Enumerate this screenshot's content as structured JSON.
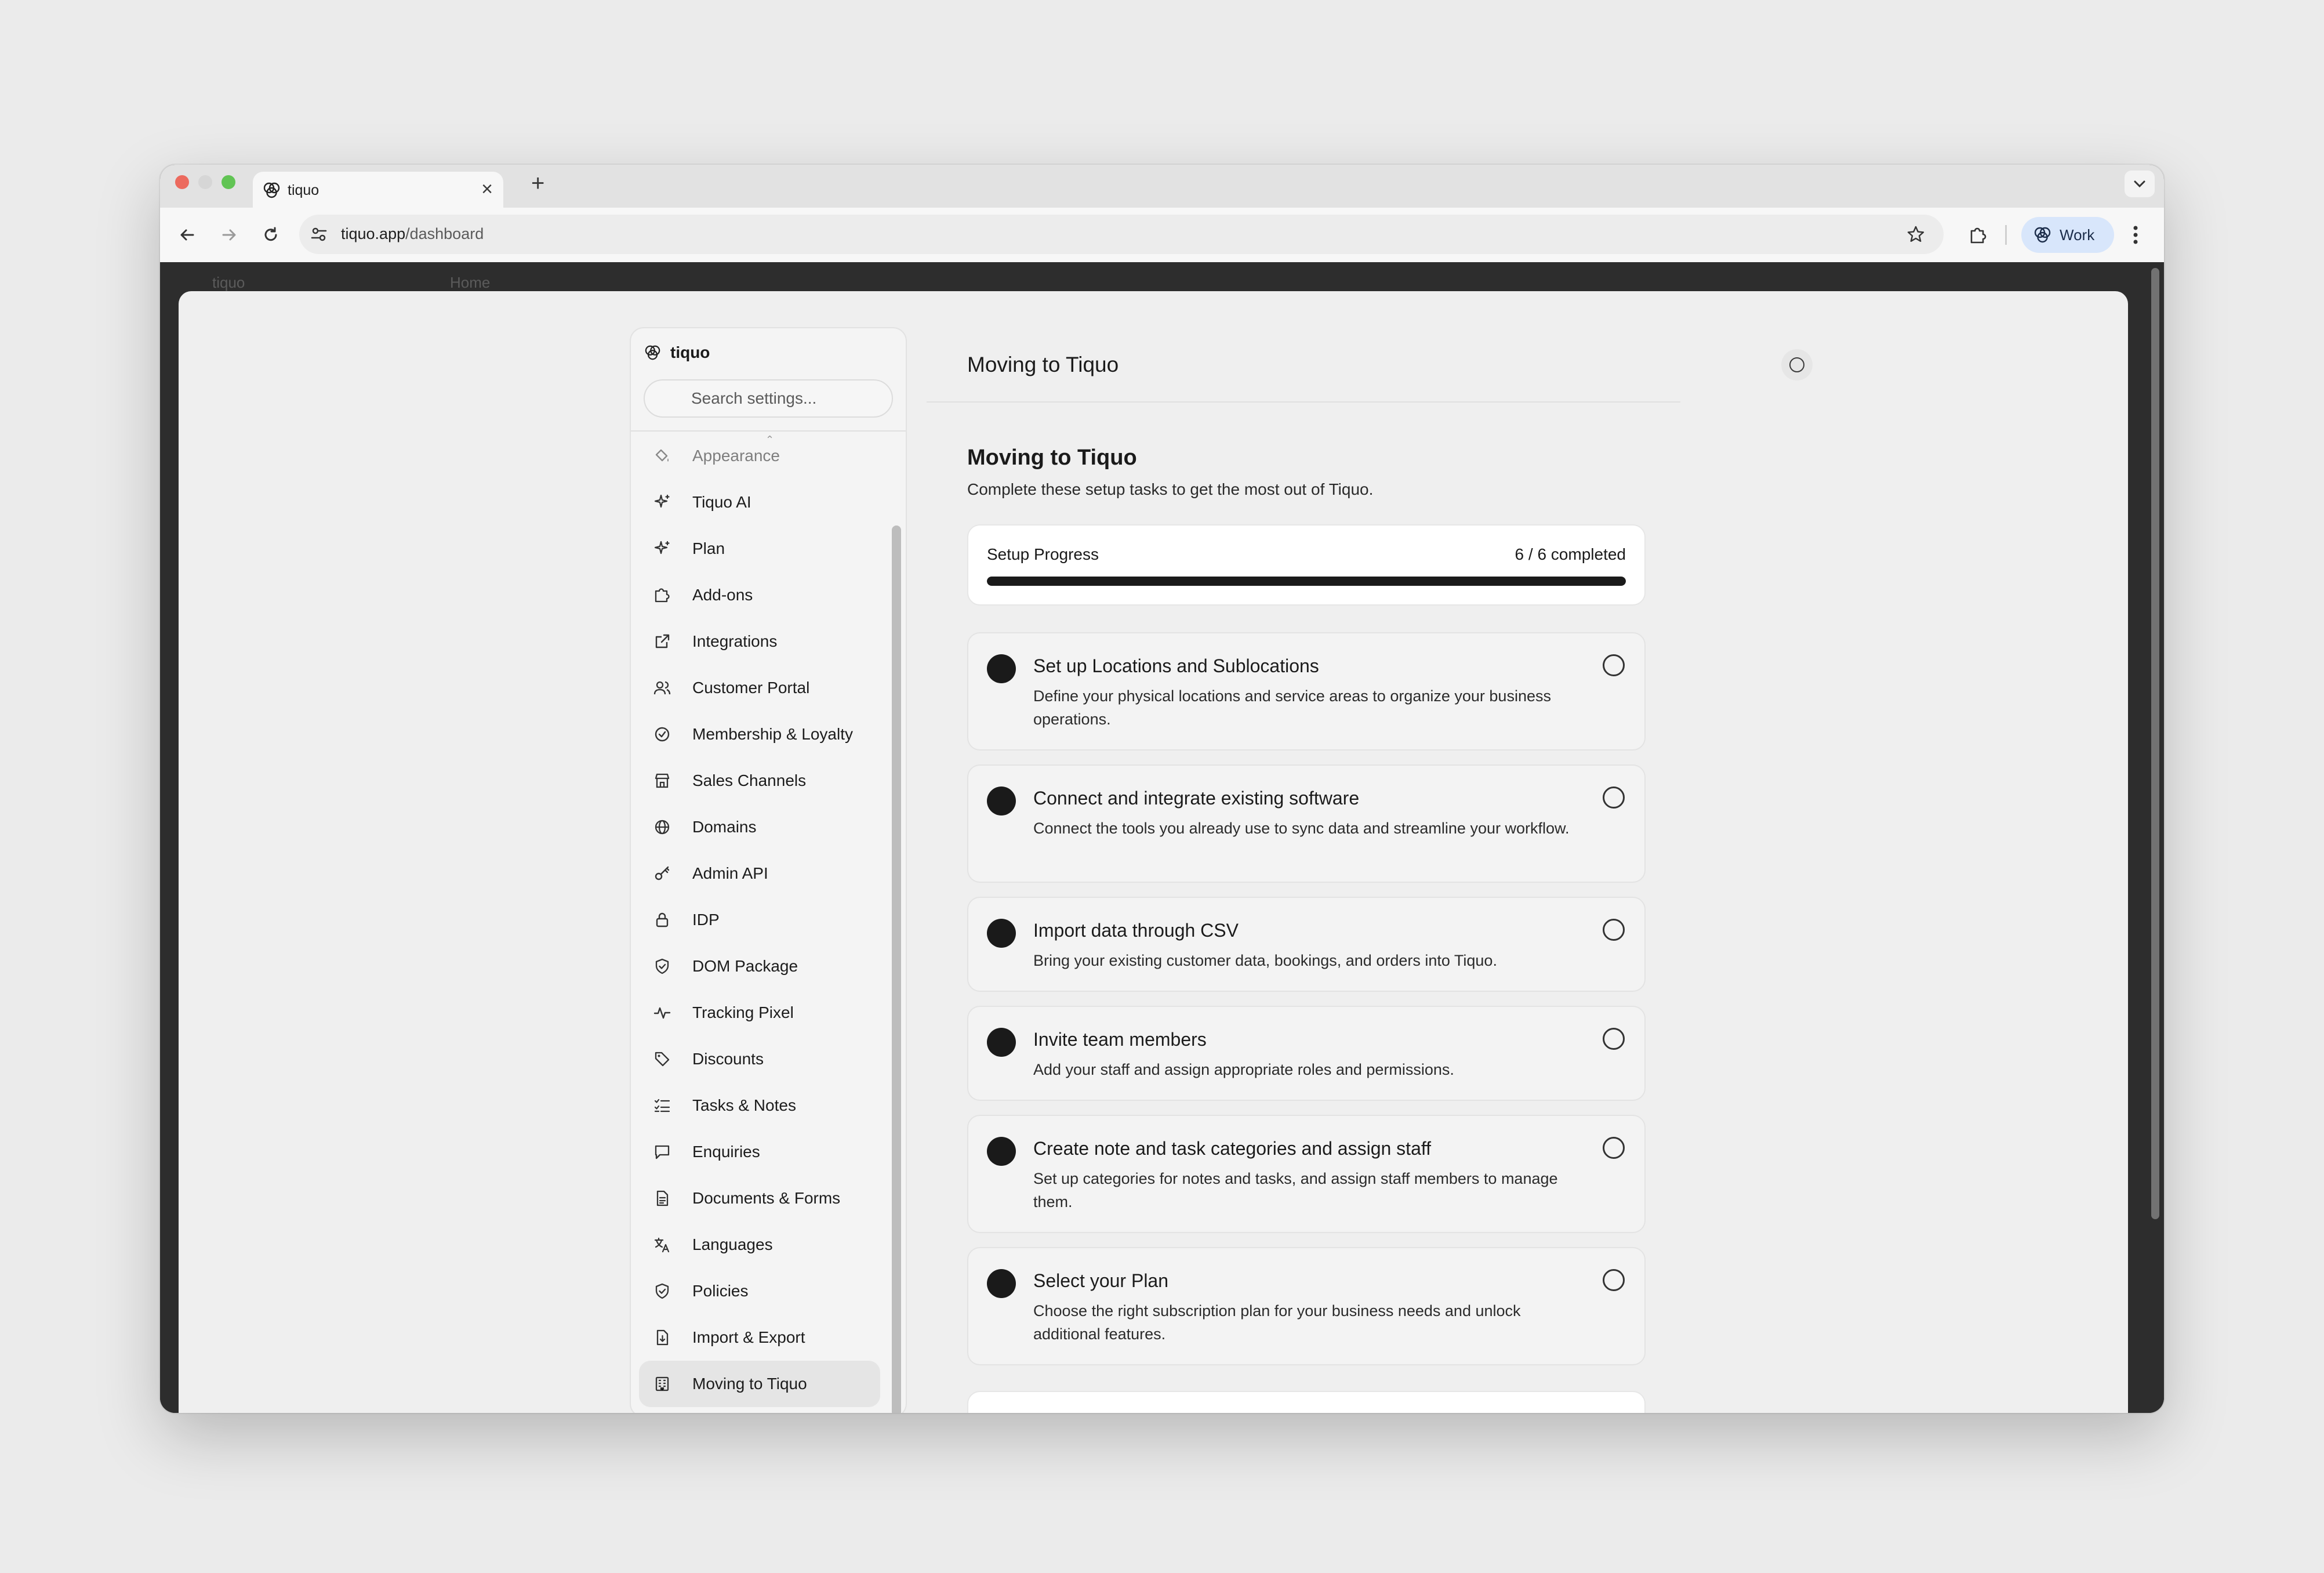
{
  "browser": {
    "tab_title": "tiquo",
    "new_tab_symbol": "+",
    "close_symbol": "×",
    "url_host": "tiquo.app",
    "url_path": "/dashboard",
    "profile_label": "Work",
    "profile_color": "#d8e6fb"
  },
  "background_app": {
    "left_text": "tiquo",
    "center_text": "Home"
  },
  "settings": {
    "brand": "tiquo",
    "search_placeholder": "Search settings...",
    "nav_items": [
      {
        "label": "Appearance",
        "icon": "paint-bucket-icon"
      },
      {
        "label": "Tiquo AI",
        "icon": "sparkles-icon"
      },
      {
        "label": "Plan",
        "icon": "sparkles-icon"
      },
      {
        "label": "Add-ons",
        "icon": "puzzle-icon"
      },
      {
        "label": "Integrations",
        "icon": "external-link-icon"
      },
      {
        "label": "Customer Portal",
        "icon": "users-icon"
      },
      {
        "label": "Membership & Loyalty",
        "icon": "badge-check-icon"
      },
      {
        "label": "Sales Channels",
        "icon": "store-icon"
      },
      {
        "label": "Domains",
        "icon": "globe-icon"
      },
      {
        "label": "Admin API",
        "icon": "key-icon"
      },
      {
        "label": "IDP",
        "icon": "lock-icon"
      },
      {
        "label": "DOM Package",
        "icon": "shield-check-icon"
      },
      {
        "label": "Tracking Pixel",
        "icon": "activity-icon"
      },
      {
        "label": "Discounts",
        "icon": "tag-icon"
      },
      {
        "label": "Tasks & Notes",
        "icon": "list-checks-icon"
      },
      {
        "label": "Enquiries",
        "icon": "message-square-icon"
      },
      {
        "label": "Documents & Forms",
        "icon": "file-text-icon"
      },
      {
        "label": "Languages",
        "icon": "languages-icon"
      },
      {
        "label": "Policies",
        "icon": "shield-check-icon"
      },
      {
        "label": "Import & Export",
        "icon": "file-import-icon"
      },
      {
        "label": "Moving to Tiquo",
        "icon": "building-icon"
      }
    ],
    "active_item": "Moving to Tiquo"
  },
  "content": {
    "header_title": "Moving to Tiquo",
    "section_title": "Moving to Tiquo",
    "section_subtitle": "Complete these setup tasks to get the most out of Tiquo.",
    "progress": {
      "label": "Setup Progress",
      "count_text": "6 / 6 completed",
      "completed": 6,
      "total": 6
    },
    "tasks": [
      {
        "title": "Set up Locations and Sublocations",
        "description": "Define your physical locations and service areas to organize your business operations."
      },
      {
        "title": "Connect and integrate existing software",
        "description": "Connect the tools you already use to sync data and streamline your workflow."
      },
      {
        "title": "Import data through CSV",
        "description": "Bring your existing customer data, bookings, and orders into Tiquo."
      },
      {
        "title": "Invite team members",
        "description": "Add your staff and assign appropriate roles and permissions."
      },
      {
        "title": "Create note and task categories and assign staff",
        "description": "Set up categories for notes and tasks, and assign staff members to manage them."
      },
      {
        "title": "Select your Plan",
        "description": "Choose the right subscription plan for your business needs and unlock additional features."
      }
    ]
  }
}
